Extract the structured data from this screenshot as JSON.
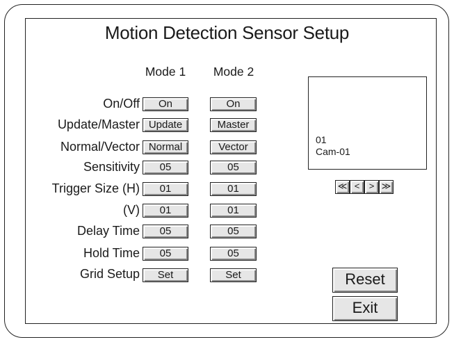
{
  "title": "Motion Detection Sensor Setup",
  "columns": {
    "mode1": "Mode 1",
    "mode2": "Mode 2"
  },
  "rows": [
    {
      "label": "On/Off",
      "mode1": "On",
      "mode2": "On"
    },
    {
      "label": "Update/Master",
      "mode1": "Update",
      "mode2": "Master"
    },
    {
      "label": "Normal/Vector",
      "mode1": "Normal",
      "mode2": "Vector"
    },
    {
      "label": "Sensitivity",
      "mode1": "05",
      "mode2": "05"
    },
    {
      "label": "Trigger Size (H)",
      "mode1": "01",
      "mode2": "01"
    },
    {
      "label": "(V)",
      "mode1": "01",
      "mode2": "01"
    },
    {
      "label": "Delay Time",
      "mode1": "05",
      "mode2": "05"
    },
    {
      "label": "Hold Time",
      "mode1": "05",
      "mode2": "05"
    },
    {
      "label": "Grid Setup",
      "mode1": "Set",
      "mode2": "Set"
    }
  ],
  "preview": {
    "channel": "01",
    "camera_name": "Cam-01"
  },
  "navigation": {
    "first": "≪",
    "prev": "<",
    "next": ">",
    "last": "≫",
    "icons": [
      "double-left-arrow-icon",
      "left-arrow-icon",
      "right-arrow-icon",
      "double-right-arrow-icon"
    ]
  },
  "buttons": {
    "reset": "Reset",
    "exit": "Exit"
  }
}
